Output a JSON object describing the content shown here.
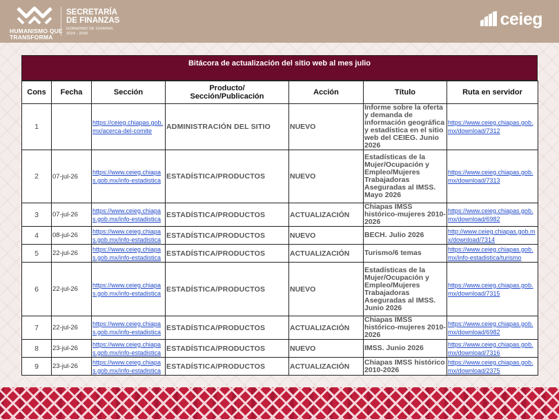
{
  "header": {
    "logo_left_line1": "HUMANISMO QUE",
    "logo_left_line2": "TRANSFORMA",
    "secretaria_line1": "SECRETARÍA",
    "secretaria_line2": "DE FINANZAS",
    "secretaria_sub": "GOBIERNO DE CHIAPAS",
    "secretaria_years": "2024 - 2030",
    "brand": "ceieg"
  },
  "table": {
    "title": "Bitácora de actualización del sitio web al mes julio",
    "columns": {
      "cons": "Cons",
      "fecha": "Fecha",
      "seccion": "Sección",
      "producto_line1": "Producto/",
      "producto_line2": "Sección/Publicación",
      "accion": "Acción",
      "titulo": "Título",
      "ruta": "Ruta en servidor"
    },
    "rows": [
      {
        "cons": "1",
        "fecha": "",
        "seccion": "https://ceieg.chiapas.gob.mx/acerca-del-comite",
        "producto": "ADMINISTRACIÓN DEL SITIO",
        "accion": "NUEVO",
        "titulo": "Informe sobre la oferta y demanda de información geográfica y estadística en el sitio web del CEIEG. Junio 2026",
        "ruta": "https://www.ceieg.chiapas.gob.mx/download/7312"
      },
      {
        "cons": "2",
        "fecha": "07-jul-26",
        "seccion": "https://www.ceieg.chiapas.gob.mx/info-estadistica",
        "producto": "ESTADÍSTICA/PRODUCTOS",
        "accion": "NUEVO",
        "titulo": "Estadísticas de la Mujer/Ocupación y Empleo/Mujeres Trabajadoras Aseguradas al IMSS. Mayo 2026",
        "ruta": "https://www.ceieg.chiapas.gob.mx/download/7313"
      },
      {
        "cons": "3",
        "fecha": "07-jul-26",
        "seccion": "https://www.ceieg.chiapas.gob.mx/info-estadistica",
        "producto": "ESTADÍSTICA/PRODUCTOS",
        "accion": "ACTUALIZACIÓN",
        "titulo": "Chiapas IMSS histórico-mujeres 2010-2026",
        "ruta": "https://www.ceieg.chiapas.gob.mx/download/6982"
      },
      {
        "cons": "4",
        "fecha": "08-jul-26",
        "seccion": "https://www.ceieg.chiapas.gob.mx/info-estadistica",
        "producto": "ESTADÍSTICA/PRODUCTOS",
        "accion": "NUEVO",
        "titulo": "BECH. Julio 2026",
        "ruta": "http://www.ceieg.chiapas.gob.mx/download/7314"
      },
      {
        "cons": "5",
        "fecha": "22-jul-26",
        "seccion": "https://www.ceieg.chiapas.gob.mx/info-estadistica",
        "producto": "ESTADÍSTICA/PRODUCTOS",
        "accion": "ACTUALIZACIÓN",
        "titulo": "Turismo/6 temas",
        "ruta": "https://www.ceieg.chiapas.gob.mx/info-estadistica/turismo"
      },
      {
        "cons": "6",
        "fecha": "22-jul-26",
        "seccion": "https://www.ceieg.chiapas.gob.mx/info-estadistica",
        "producto": "ESTADÍSTICA/PRODUCTOS",
        "accion": "NUEVO",
        "titulo": "Estadísticas de la Mujer/Ocupación y Empleo/Mujeres Trabajadoras Aseguradas al IMSS. Junio 2026",
        "ruta": "https://www.ceieg.chiapas.gob.mx/download/7315"
      },
      {
        "cons": "7",
        "fecha": "22-jul-26",
        "seccion": "https://www.ceieg.chiapas.gob.mx/info-estadistica",
        "producto": "ESTADÍSTICA/PRODUCTOS",
        "accion": "ACTUALIZACIÓN",
        "titulo": "Chiapas IMSS histórico-mujeres 2010-2026",
        "ruta": "https://www.ceieg.chiapas.gob.mx/download/6982"
      },
      {
        "cons": "8",
        "fecha": "23-jul-26",
        "seccion": "https://www.ceieg.chiapas.gob.mx/info-estadistica",
        "producto": "ESTADÍSTICA/PRODUCTOS",
        "accion": "NUEVO",
        "titulo": "IMSS. Junio 2026",
        "ruta": "https://www.ceieg.chiapas.gob.mx/download/7316"
      },
      {
        "cons": "9",
        "fecha": "23-jul-26",
        "seccion": "https://www.ceieg.chiapas.gob.mx/info-estadistica",
        "producto": "ESTADÍSTICA/PRODUCTOS",
        "accion": "ACTUALIZACIÓN",
        "titulo": "Chiapas IMSS histórico 2010-2026",
        "ruta": "https://www.ceieg.chiapas.gob.mx/download/2375"
      }
    ]
  },
  "colors": {
    "title_bar": "#6a0b2b",
    "header_band": "#bca693",
    "link": "#1f49c9",
    "bottom_band": "#c11f3b"
  }
}
